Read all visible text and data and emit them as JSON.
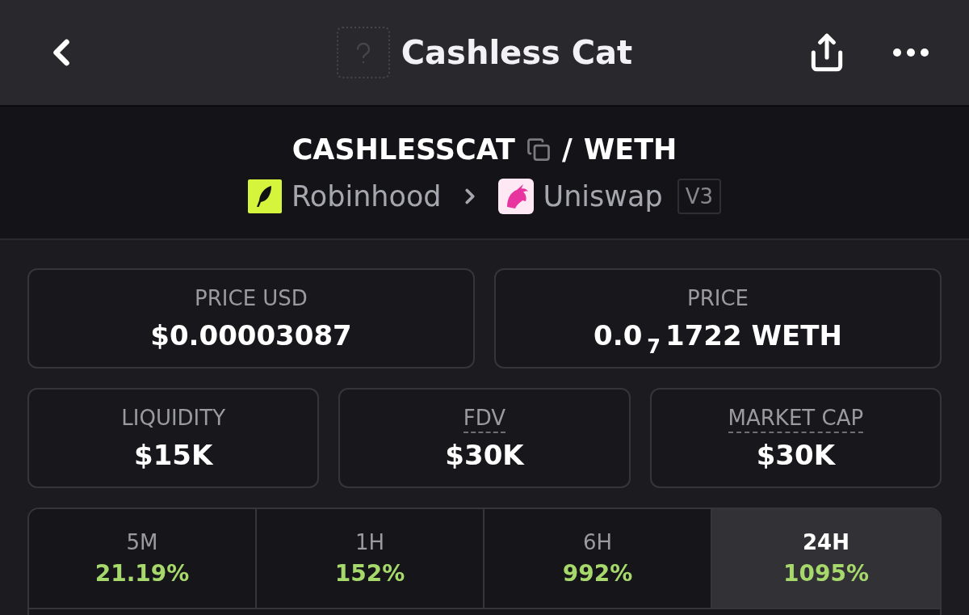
{
  "header": {
    "title": "Cashless Cat"
  },
  "pair": {
    "base": "CASHLESSCAT",
    "separator": "/",
    "quote": "WETH",
    "chain": "Robinhood",
    "dex": "Uniswap",
    "version": "V3"
  },
  "stats_top": [
    {
      "label": "PRICE USD",
      "value": "$0.00003087",
      "dotted_label": false
    },
    {
      "label": "PRICE",
      "value": "0.0$_{7}$1722 WETH",
      "dotted_label": false
    }
  ],
  "stats_bottom": [
    {
      "label": "LIQUIDITY",
      "value": "$15K",
      "dotted_label": false
    },
    {
      "label": "FDV",
      "value": "$30K",
      "dotted_label": true
    },
    {
      "label": "MARKET CAP",
      "value": "$30K",
      "dotted_label": true
    }
  ],
  "timeframes": [
    {
      "label": "5M",
      "change": "21.19%",
      "selected": false
    },
    {
      "label": "1H",
      "change": "152%",
      "selected": false
    },
    {
      "label": "6H",
      "change": "992%",
      "selected": false
    },
    {
      "label": "24H",
      "change": "1095%",
      "selected": true
    }
  ]
}
